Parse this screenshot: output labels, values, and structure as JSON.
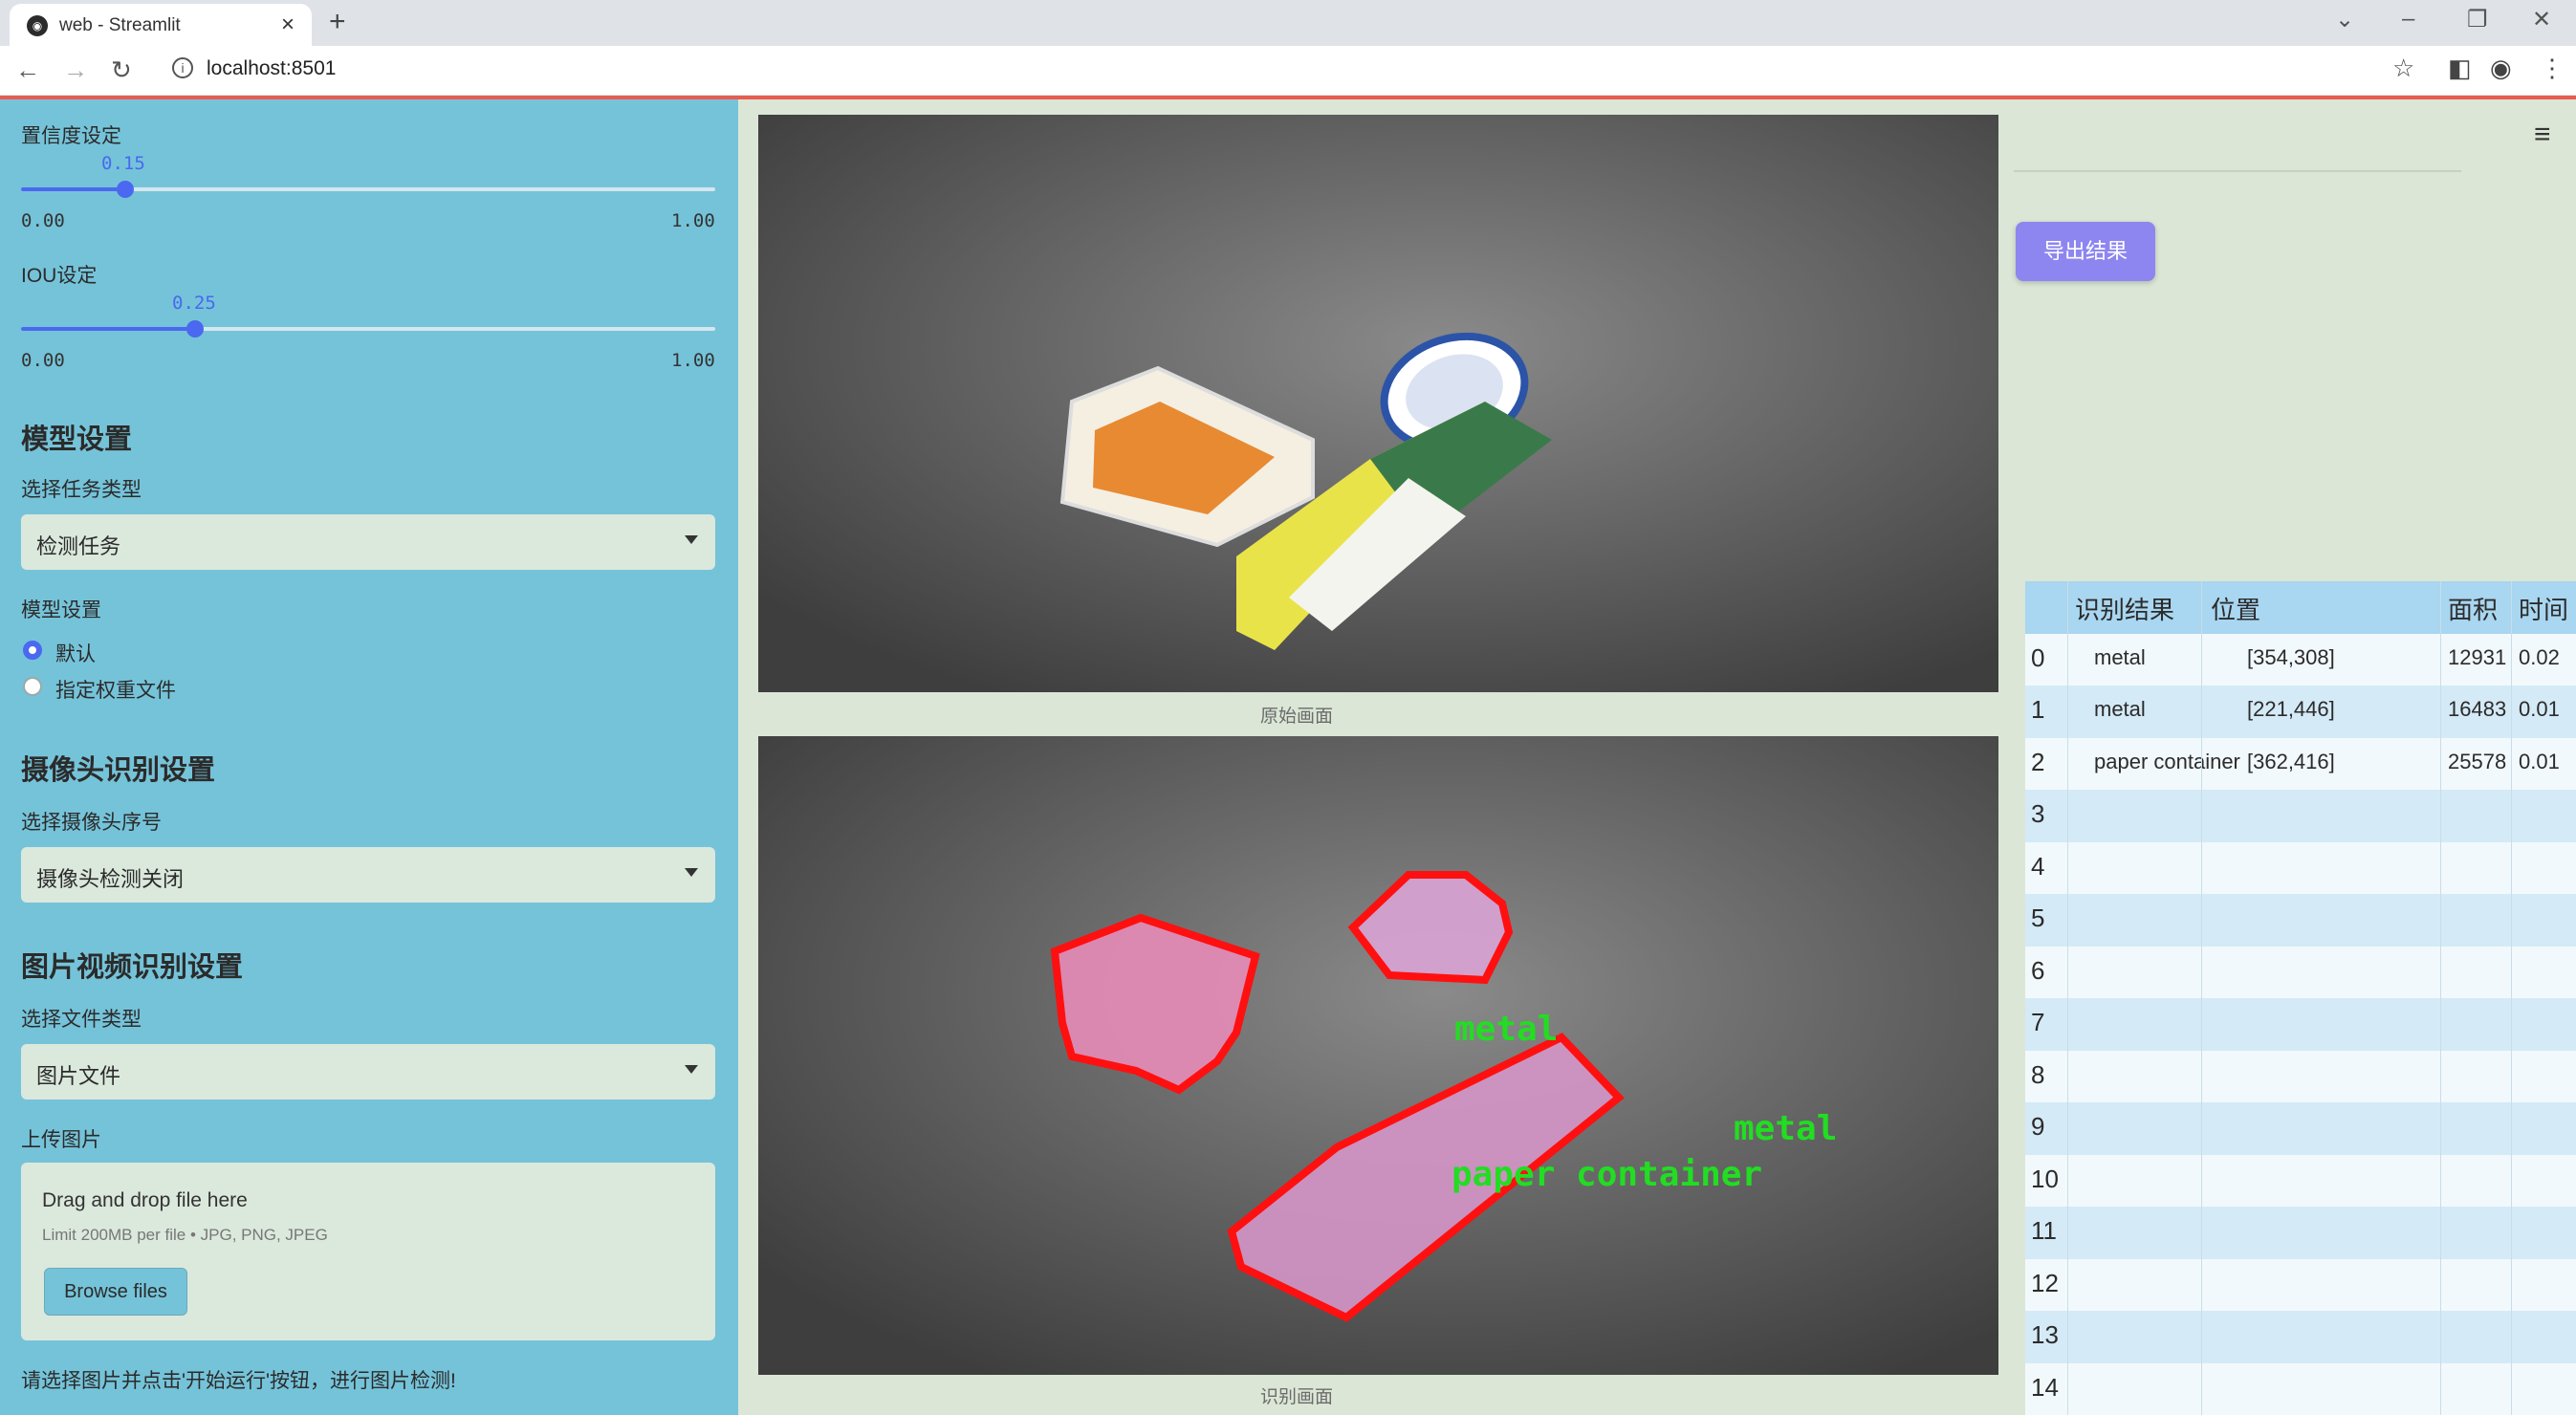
{
  "browser": {
    "tab_title": "web - Streamlit",
    "url": "localhost:8501"
  },
  "sidebar": {
    "confidence": {
      "label": "置信度设定",
      "value": "0.15",
      "min": "0.00",
      "max": "1.00",
      "fraction": 0.15
    },
    "iou": {
      "label": "IOU设定",
      "value": "0.25",
      "min": "0.00",
      "max": "1.00",
      "fraction": 0.25
    },
    "model_section": {
      "title": "模型设置",
      "task_label": "选择任务类型",
      "task_value": "检测任务",
      "model_label": "模型设置",
      "radio_default": "默认",
      "radio_custom": "指定权重文件"
    },
    "camera_section": {
      "title": "摄像头识别设置",
      "camera_label": "选择摄像头序号",
      "camera_value": "摄像头检测关闭"
    },
    "media_section": {
      "title": "图片视频识别设置",
      "filetype_label": "选择文件类型",
      "filetype_value": "图片文件",
      "upload_label": "上传图片",
      "drop_text": "Drag and drop file here",
      "limit_text": "Limit 200MB per file • JPG, PNG, JPEG",
      "browse_label": "Browse files"
    },
    "hint": "请选择图片并点击'开始运行'按钮，进行图片检测!"
  },
  "main": {
    "original_caption": "原始画面",
    "detect_caption": "识别画面",
    "detections": [
      {
        "label": "metal"
      },
      {
        "label": "metal"
      },
      {
        "label": "paper container"
      }
    ],
    "colors": {
      "box": "#ff1010",
      "text": "#22dd22"
    }
  },
  "right": {
    "export_label": "导出结果",
    "table": {
      "headers": [
        "识别结果",
        "位置",
        "面积",
        "时间"
      ],
      "rows": [
        {
          "idx": "0",
          "result": "metal",
          "pos": "[354,308]",
          "area": "12931",
          "time": "0.02"
        },
        {
          "idx": "1",
          "result": "metal",
          "pos": "[221,446]",
          "area": "16483",
          "time": "0.01"
        },
        {
          "idx": "2",
          "result": "paper container",
          "pos": "[362,416]",
          "area": "25578",
          "time": "0.01"
        },
        {
          "idx": "3",
          "result": "",
          "pos": "",
          "area": "",
          "time": ""
        },
        {
          "idx": "4",
          "result": "",
          "pos": "",
          "area": "",
          "time": ""
        },
        {
          "idx": "5",
          "result": "",
          "pos": "",
          "area": "",
          "time": ""
        },
        {
          "idx": "6",
          "result": "",
          "pos": "",
          "area": "",
          "time": ""
        },
        {
          "idx": "7",
          "result": "",
          "pos": "",
          "area": "",
          "time": ""
        },
        {
          "idx": "8",
          "result": "",
          "pos": "",
          "area": "",
          "time": ""
        },
        {
          "idx": "9",
          "result": "",
          "pos": "",
          "area": "",
          "time": ""
        },
        {
          "idx": "10",
          "result": "",
          "pos": "",
          "area": "",
          "time": ""
        },
        {
          "idx": "11",
          "result": "",
          "pos": "",
          "area": "",
          "time": ""
        },
        {
          "idx": "12",
          "result": "",
          "pos": "",
          "area": "",
          "time": ""
        },
        {
          "idx": "13",
          "result": "",
          "pos": "",
          "area": "",
          "time": ""
        },
        {
          "idx": "14",
          "result": "",
          "pos": "",
          "area": "",
          "time": ""
        }
      ]
    }
  }
}
